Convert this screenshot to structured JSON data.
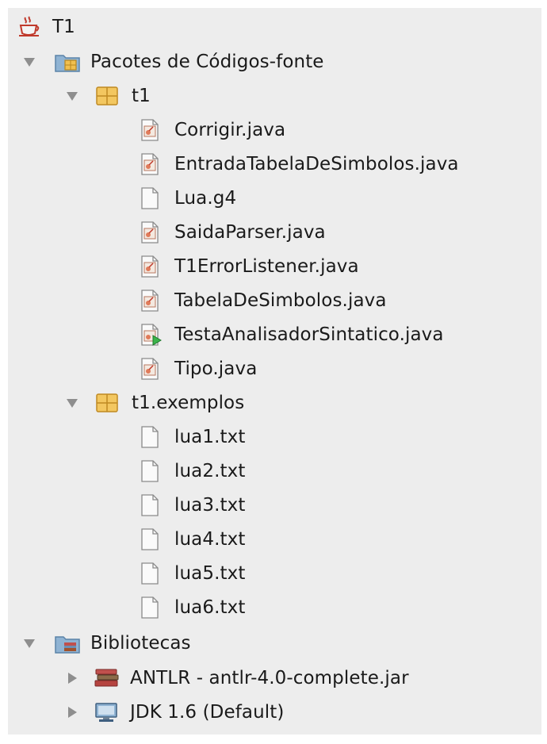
{
  "project": {
    "name": "T1",
    "icon": "java-cup-icon"
  },
  "source_packages": {
    "label": "Pacotes de Códigos-fonte",
    "icon": "source-packages-folder-icon",
    "expanded": true,
    "packages": [
      {
        "name": "t1",
        "icon": "package-icon",
        "expanded": true,
        "files": [
          {
            "name": "Corrigir.java",
            "icon": "java-class-icon"
          },
          {
            "name": "EntradaTabelaDeSimbolos.java",
            "icon": "java-class-icon"
          },
          {
            "name": "Lua.g4",
            "icon": "text-file-icon"
          },
          {
            "name": "SaidaParser.java",
            "icon": "java-class-icon"
          },
          {
            "name": "T1ErrorListener.java",
            "icon": "java-class-icon"
          },
          {
            "name": "TabelaDeSimbolos.java",
            "icon": "java-class-icon"
          },
          {
            "name": "TestaAnalisadorSintatico.java",
            "icon": "java-main-class-icon"
          },
          {
            "name": "Tipo.java",
            "icon": "java-class-icon"
          }
        ]
      },
      {
        "name": "t1.exemplos",
        "icon": "package-icon",
        "expanded": true,
        "files": [
          {
            "name": "lua1.txt",
            "icon": "text-file-icon"
          },
          {
            "name": "lua2.txt",
            "icon": "text-file-icon"
          },
          {
            "name": "lua3.txt",
            "icon": "text-file-icon"
          },
          {
            "name": "lua4.txt",
            "icon": "text-file-icon"
          },
          {
            "name": "lua5.txt",
            "icon": "text-file-icon"
          },
          {
            "name": "lua6.txt",
            "icon": "text-file-icon"
          }
        ]
      }
    ]
  },
  "libraries": {
    "label": "Bibliotecas",
    "icon": "libraries-folder-icon",
    "expanded": true,
    "items": [
      {
        "name": "ANTLR - antlr-4.0-complete.jar",
        "icon": "library-books-icon",
        "expanded": false
      },
      {
        "name": "JDK 1.6 (Default)",
        "icon": "jdk-monitor-icon",
        "expanded": false
      }
    ]
  },
  "colors": {
    "panel_bg": "#ededed",
    "text": "#1a1a1a",
    "disclosure_triangle": "#8e8e8e",
    "package_icon": "#e8b64a",
    "folder_icon": "#7fa7c9"
  }
}
